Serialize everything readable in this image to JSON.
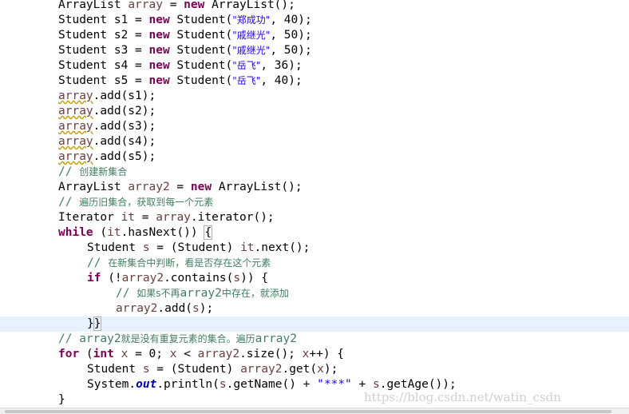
{
  "editor": {
    "lines": {
      "l0": {
        "a": "ArrayList ",
        "b": "array",
        "c": " = ",
        "d": "new",
        "e": " ArrayList();"
      },
      "l1": {
        "a": "Student s1 = ",
        "b": "new",
        "c": " Student(",
        "d": "\"郑成功\"",
        "e": ", 40);"
      },
      "l2": {
        "a": "Student s2 = ",
        "b": "new",
        "c": " Student(",
        "d": "\"戚继光\"",
        "e": ", 50);"
      },
      "l3": {
        "a": "Student s3 = ",
        "b": "new",
        "c": " Student(",
        "d": "\"戚继光\"",
        "e": ", 50);"
      },
      "l4": {
        "a": "Student s4 = ",
        "b": "new",
        "c": " Student(",
        "d": "\"岳飞\"",
        "e": ", 36);"
      },
      "l5": {
        "a": "Student s5 = ",
        "b": "new",
        "c": " Student(",
        "d": "\"岳飞\"",
        "e": ", 40);"
      },
      "l6": {
        "a": "array",
        "b": ".add(s1);"
      },
      "l7": {
        "a": "array",
        "b": ".add(s2);"
      },
      "l8": {
        "a": "array",
        "b": ".add(s3);"
      },
      "l9": {
        "a": "array",
        "b": ".add(s4);"
      },
      "l10": {
        "a": "array",
        "b": ".add(s5);"
      },
      "l11": {
        "a": "// ",
        "b": "创建新集合"
      },
      "l12": {
        "a": "ArrayList ",
        "b": "array2",
        "c": " = ",
        "d": "new",
        "e": " ArrayList();"
      },
      "l13": {
        "a": "// ",
        "b": "遍历旧集合，获取到每一个元素"
      },
      "l14": {
        "a": "Iterator ",
        "b": "it",
        "c": " = ",
        "d": "array",
        "e": ".iterator();"
      },
      "l15": {
        "a": "while",
        "b": " (",
        "c": "it",
        "d": ".hasNext()) ",
        "e": "{"
      },
      "l16": {
        "a": "Student ",
        "b": "s",
        "c": " = (Student) ",
        "d": "it",
        "e": ".next();"
      },
      "l17": {
        "a": "// ",
        "b": "在新集合中判断，看是否存在这个元素"
      },
      "l18": {
        "a": "if",
        "b": " (!",
        "c": "array2",
        "d": ".contains(",
        "e": "s",
        "f": ")) {"
      },
      "l19": {
        "a": "// ",
        "b": "如果s不再",
        "c": "array2",
        "d": "中存在，就添加"
      },
      "l20": {
        "a": "array2",
        "b": ".add(",
        "c": "s",
        "d": ");"
      },
      "l21": {
        "a": "}",
        "b": "}"
      },
      "l22": {
        "a": "// ",
        "b": "array2",
        "c": "就是没有重复元素的集合。遍历",
        "d": "array2"
      },
      "l23": {
        "a": "for",
        "b": " (",
        "c": "int",
        "d": " ",
        "e": "x",
        "f": " = 0; ",
        "g": "x",
        "h": " < ",
        "i": "array2",
        "j": ".size(); ",
        "k": "x",
        "l": "++) {"
      },
      "l24": {
        "a": "Student ",
        "b": "s",
        "c": " = (Student) ",
        "d": "array2",
        "e": ".get(",
        "f": "x",
        "g": ");"
      },
      "l25": {
        "a": "System.",
        "b": "out",
        "c": ".println(",
        "d": "s",
        "e": ".getName() + ",
        "f": "\"***\"",
        "g": " + ",
        "h": "s",
        "i": ".getAge());"
      },
      "l26": {
        "a": "}"
      }
    }
  },
  "watermark": "https://blog.csdn.net/watin_csdn",
  "colors": {
    "keyword": "#7f0055",
    "string": "#2a00ff",
    "comment": "#3f7f5f",
    "local_variable": "#6a3e3e",
    "static_field": "#0000c0",
    "current_line": "#e8f2fe"
  }
}
